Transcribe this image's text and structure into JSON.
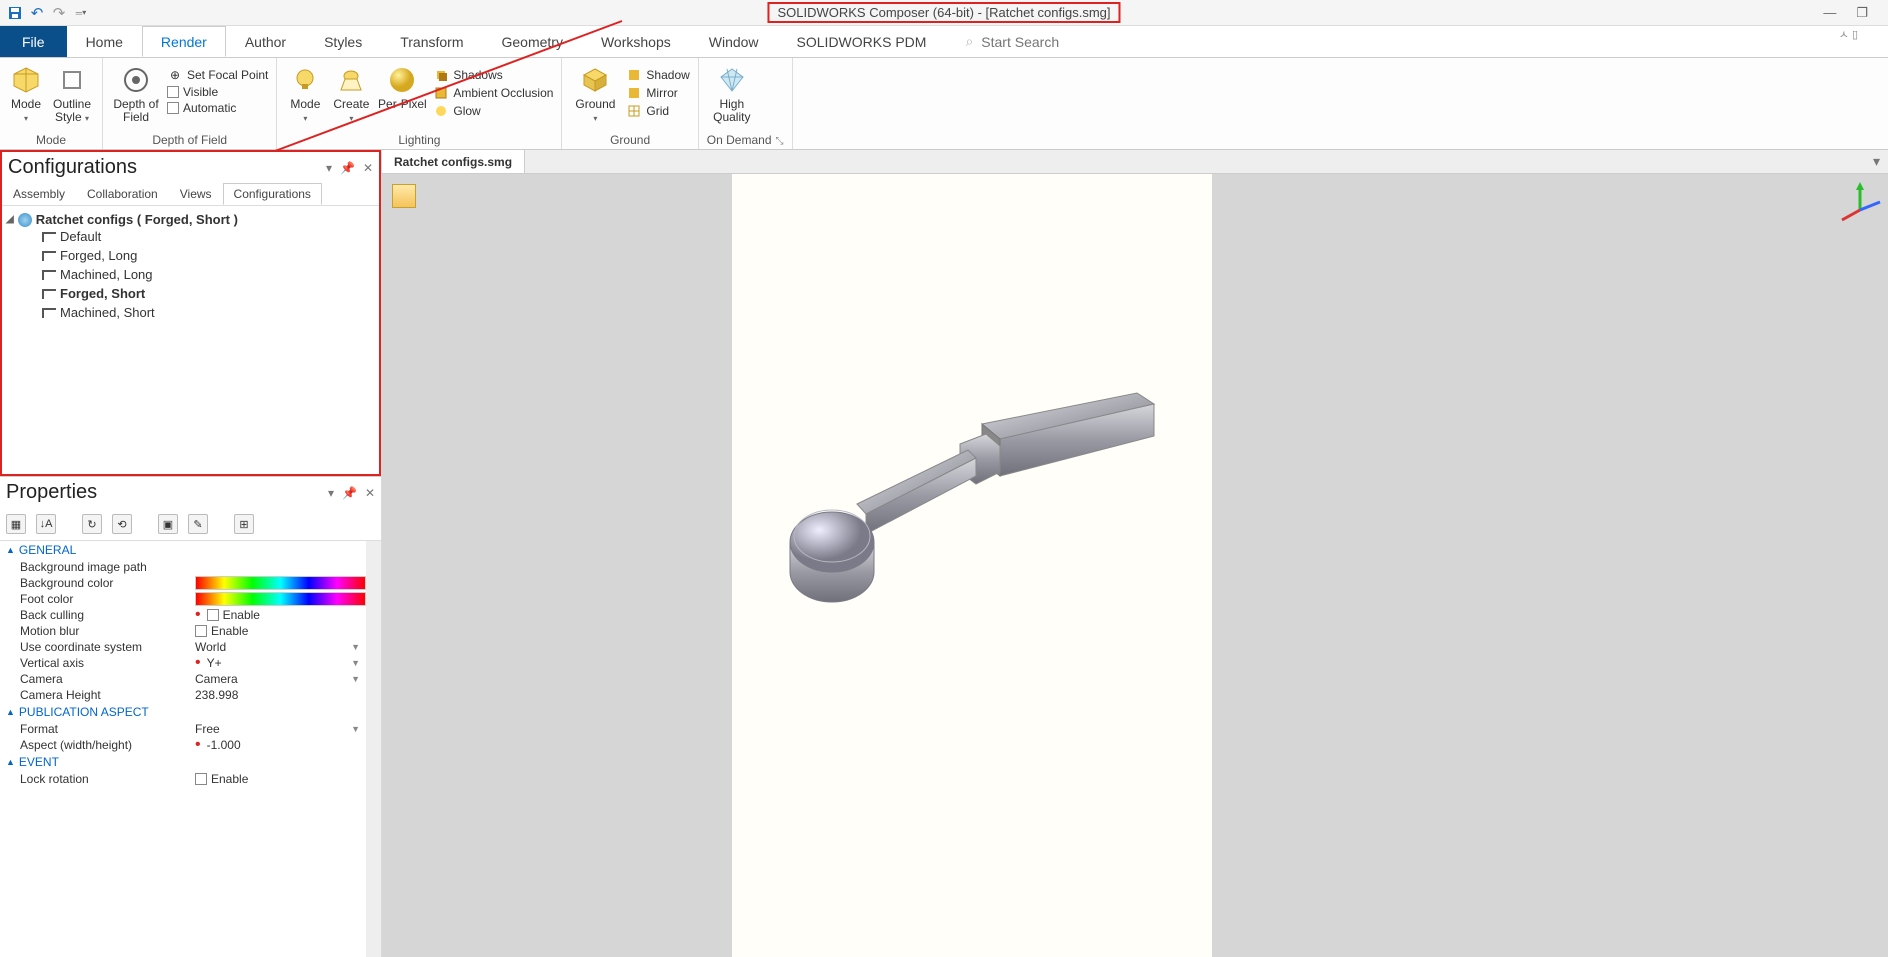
{
  "title": "SOLIDWORKS Composer (64-bit) - [Ratchet configs.smg]",
  "window_controls": {
    "minimize": "—",
    "restore": "❐"
  },
  "qat": {
    "save": "💾",
    "undo": "↶",
    "redo": "↷",
    "more": "▾"
  },
  "menu": {
    "file": "File",
    "tabs": [
      "Home",
      "Render",
      "Author",
      "Styles",
      "Transform",
      "Geometry",
      "Workshops",
      "Window",
      "SOLIDWORKS PDM"
    ],
    "active": "Render",
    "search_placeholder": "Start Search",
    "help": "ㅅ ▯"
  },
  "ribbon": {
    "mode": {
      "label": "Mode",
      "btn1": "Mode",
      "btn2": "Outline Style"
    },
    "dof": {
      "label": "Depth of Field",
      "btn": "Depth of Field",
      "opt1": "Set Focal Point",
      "opt2": "Visible",
      "opt3": "Automatic"
    },
    "lighting": {
      "label": "Lighting",
      "btn1": "Mode",
      "btn2": "Create",
      "btn3": "Per-Pixel",
      "opt1": "Shadows",
      "opt2": "Ambient Occlusion",
      "opt3": "Glow"
    },
    "ground": {
      "label": "Ground",
      "btn": "Ground",
      "opt1": "Shadow",
      "opt2": "Mirror",
      "opt3": "Grid"
    },
    "ondemand": {
      "label": "On Demand",
      "btn": "High Quality"
    }
  },
  "configurations": {
    "title": "Configurations",
    "tabs": [
      "Assembly",
      "Collaboration",
      "Views",
      "Configurations"
    ],
    "active_tab": "Configurations",
    "root": "Ratchet configs ( Forged, Short )",
    "items": [
      {
        "label": "Default",
        "active": false
      },
      {
        "label": "Forged, Long",
        "active": false
      },
      {
        "label": "Machined, Long",
        "active": false
      },
      {
        "label": "Forged, Short",
        "active": true
      },
      {
        "label": "Machined, Short",
        "active": false
      }
    ]
  },
  "properties": {
    "title": "Properties",
    "sections": {
      "general": {
        "label": "GENERAL",
        "rows": [
          {
            "name": "Background image path",
            "value": ""
          },
          {
            "name": "Background color",
            "value": "colorbar"
          },
          {
            "name": "Foot color",
            "value": "colorbar"
          },
          {
            "name": "Back culling",
            "value": "Enable",
            "red": true,
            "check": true
          },
          {
            "name": "Motion blur",
            "value": "Enable",
            "check": true
          },
          {
            "name": "Use coordinate system",
            "value": "World",
            "dd": true
          },
          {
            "name": "Vertical axis",
            "value": "Y+",
            "red": true,
            "dd": true
          },
          {
            "name": "Camera",
            "value": "Camera",
            "dd": true
          },
          {
            "name": "Camera Height",
            "value": "238.998"
          }
        ]
      },
      "pub": {
        "label": "PUBLICATION ASPECT",
        "rows": [
          {
            "name": "Format",
            "value": "Free",
            "dd": true
          },
          {
            "name": "Aspect (width/height)",
            "value": "-1.000",
            "red": true
          }
        ]
      },
      "event": {
        "label": "EVENT",
        "rows": [
          {
            "name": "Lock rotation",
            "value": "Enable",
            "check": true
          }
        ]
      }
    }
  },
  "document": {
    "tab": "Ratchet configs.smg"
  }
}
